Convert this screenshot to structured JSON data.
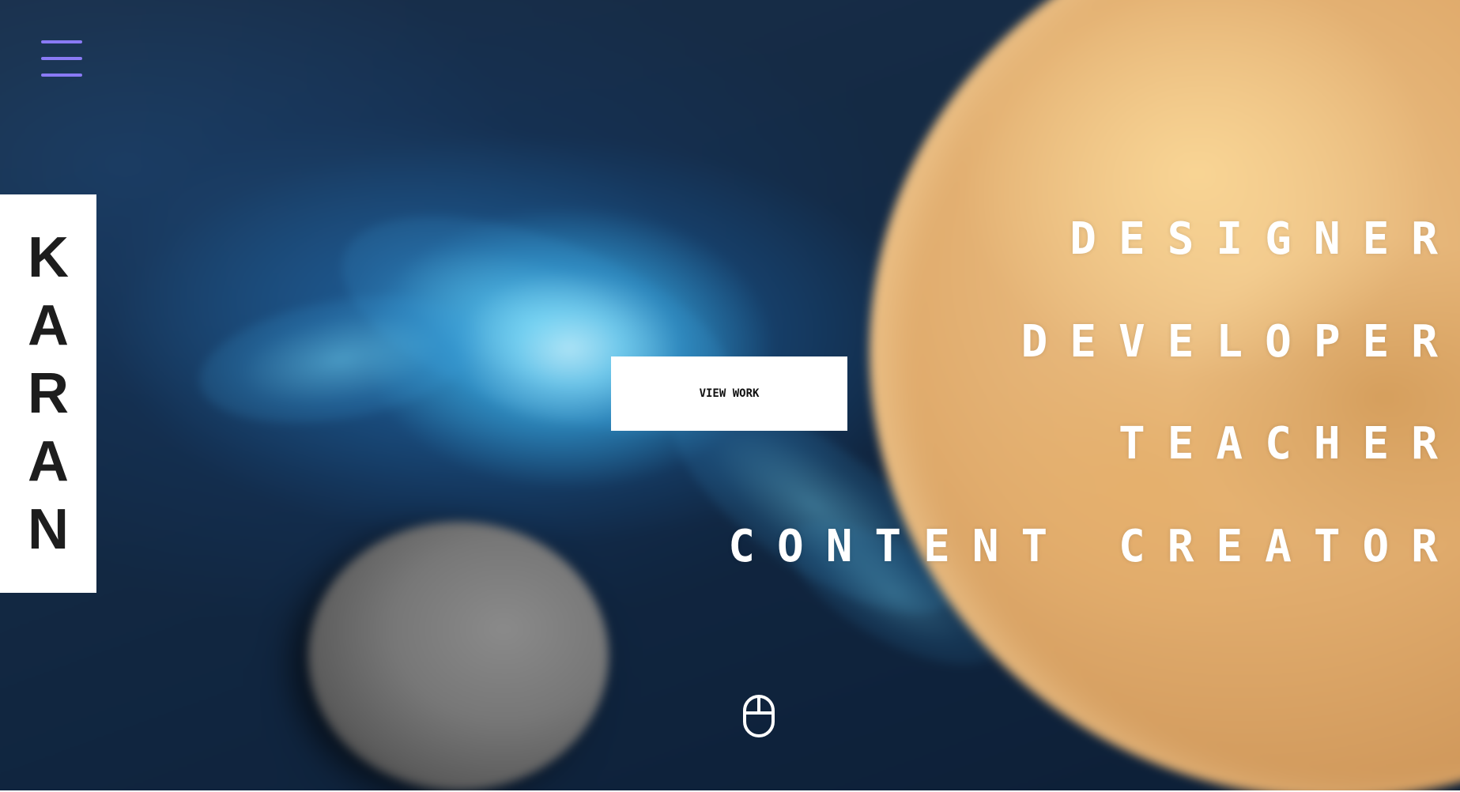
{
  "menu": {
    "icon": "hamburger-menu-icon",
    "color": "#8a7af5"
  },
  "name": {
    "letters": [
      "K",
      "A",
      "R",
      "A",
      "N"
    ]
  },
  "cta": {
    "label": "VIEW WORK"
  },
  "roles": [
    "DESIGNER",
    "DEVELOPER",
    "TEACHER",
    "CONTENT CREATOR"
  ],
  "scroll": {
    "icon": "mouse-scroll-icon"
  }
}
